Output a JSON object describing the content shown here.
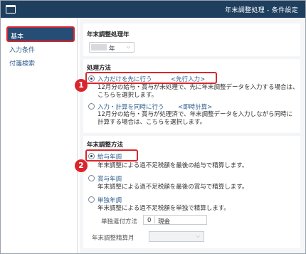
{
  "window": {
    "title": "年末調整処理 - 条件設定"
  },
  "sidebar": {
    "items": [
      {
        "label": "基本",
        "active": true
      },
      {
        "label": "入力条件",
        "active": false
      },
      {
        "label": "付箋検索",
        "active": false
      }
    ]
  },
  "year_section": {
    "heading": "年末調整処理年",
    "select_value": "年"
  },
  "method_section": {
    "heading": "処理方法",
    "options": [
      {
        "label": "入力だけを先に行う",
        "tag": "<先行入力>",
        "selected": true,
        "desc_1": "12月分の給与・賞与が未処理で、先に年末調整データを入力する場合は、",
        "desc_2": "こちらを選択します。"
      },
      {
        "label": "入力・計算を同時に行う",
        "tag": "<即時計算>",
        "selected": false,
        "desc_1": "12月分の給与・賞与が処理済で、年末調整データを入力しながら同時に",
        "desc_2": "計算する場合は、こちらを選択します。"
      }
    ]
  },
  "adjust_section": {
    "heading": "年末調整方法",
    "options": [
      {
        "label": "給与年調",
        "selected": true,
        "desc": "年末調整による過不足税額を最後の給与で精算します。"
      },
      {
        "label": "賞与年調",
        "selected": false,
        "desc": "年末調整による過不足税額を最後の賞与で精算します。"
      },
      {
        "label": "単独年調",
        "selected": false,
        "desc": "年末調整による過不足税額を単独で精算します。"
      }
    ],
    "payment_method_label": "単独遣付方法",
    "payment_method_code": "0",
    "payment_method_value": "現金",
    "settlement_month_label": "年末調整精算月"
  },
  "annotations": {
    "marker_1": "1",
    "marker_2": "2"
  },
  "colors": {
    "titlebar": "#1f3f5f",
    "accent_red": "#d9262c",
    "link_blue": "#2e5f8f",
    "active_item": "#264d75"
  }
}
